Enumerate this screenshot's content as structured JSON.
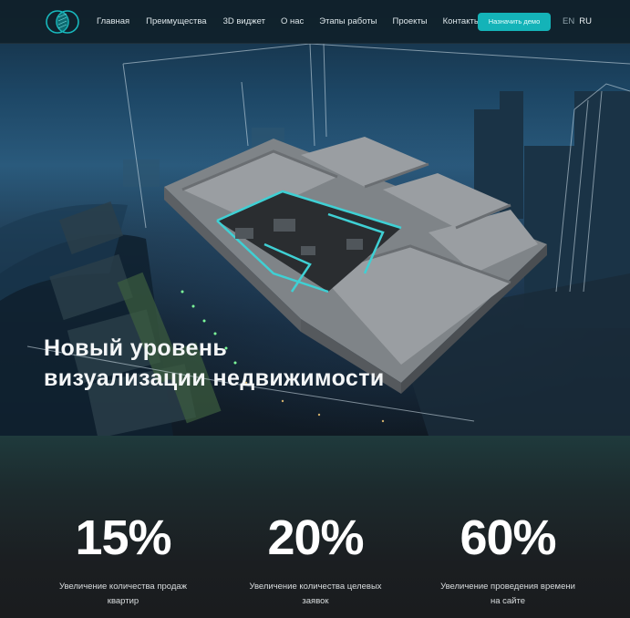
{
  "header": {
    "logo_icon": "overlapping-circles-logo-icon",
    "nav": [
      "Главная",
      "Преимущества",
      "3D виджет",
      "О нас",
      "Этапы работы",
      "Проекты",
      "Контакты"
    ],
    "demo_button": "Назначить демо",
    "lang_en": "EN",
    "lang_ru": "RU",
    "accent_color": "#14b3b8"
  },
  "hero": {
    "title_line1": "Новый уровень",
    "title_line2": "визуализации недвижимости",
    "image": "3d-apartment-floorplan-over-city-aerial"
  },
  "stats": [
    {
      "value": "15%",
      "label_line1": "Увеличение количества продаж",
      "label_line2": "квартир"
    },
    {
      "value": "20%",
      "label_line1": "Увеличение количества целевых",
      "label_line2": "заявок"
    },
    {
      "value": "60%",
      "label_line1": "Увеличение проведения времени",
      "label_line2": "на сайте"
    }
  ]
}
